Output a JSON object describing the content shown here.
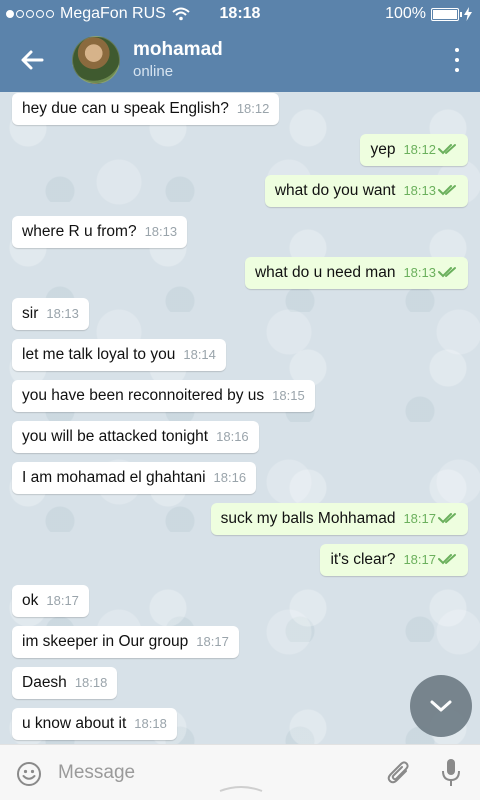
{
  "status_bar": {
    "carrier": "MegaFon RUS",
    "time": "18:18",
    "battery": "100%",
    "battery_level": 1.0
  },
  "header": {
    "contact_name": "mohamad",
    "contact_status": "online"
  },
  "messages": [
    {
      "dir": "in",
      "text": "hey due can u speak English?",
      "time": "18:12"
    },
    {
      "dir": "out",
      "text": "yep",
      "time": "18:12"
    },
    {
      "dir": "out",
      "text": "what do you want",
      "time": "18:13"
    },
    {
      "dir": "in",
      "text": "where R u from?",
      "time": "18:13"
    },
    {
      "dir": "out",
      "text": "what do u need man",
      "time": "18:13"
    },
    {
      "dir": "in",
      "text": "sir",
      "time": "18:13"
    },
    {
      "dir": "in",
      "text": "let me talk loyal to you",
      "time": "18:14"
    },
    {
      "dir": "in",
      "text": "you have been reconnoitered by us",
      "time": "18:15"
    },
    {
      "dir": "in",
      "text": "you will be attacked tonight",
      "time": "18:16"
    },
    {
      "dir": "in",
      "text": "I am mohamad el ghahtani",
      "time": "18:16"
    },
    {
      "dir": "out",
      "text": "suck my balls Mohhamad",
      "time": "18:17"
    },
    {
      "dir": "out",
      "text": "it's clear?",
      "time": "18:17"
    },
    {
      "dir": "in",
      "text": "ok",
      "time": "18:17"
    },
    {
      "dir": "in",
      "text": "im skeeper in Our group",
      "time": "18:17"
    },
    {
      "dir": "in",
      "text": "Daesh",
      "time": "18:18"
    },
    {
      "dir": "in",
      "text": "u know about it",
      "time": "18:18"
    }
  ],
  "composer": {
    "placeholder": "Message"
  },
  "icons": {
    "back": "arrow-left-icon",
    "menu": "more-vertical-icon",
    "scroll": "chevron-down-icon",
    "emoji": "smiley-icon",
    "attach": "paperclip-icon",
    "mic": "microphone-icon"
  },
  "colors": {
    "header": "#5b83ab",
    "incoming_bubble": "#ffffff",
    "outgoing_bubble": "#eefedf",
    "read_ticks": "#6bb05d"
  }
}
